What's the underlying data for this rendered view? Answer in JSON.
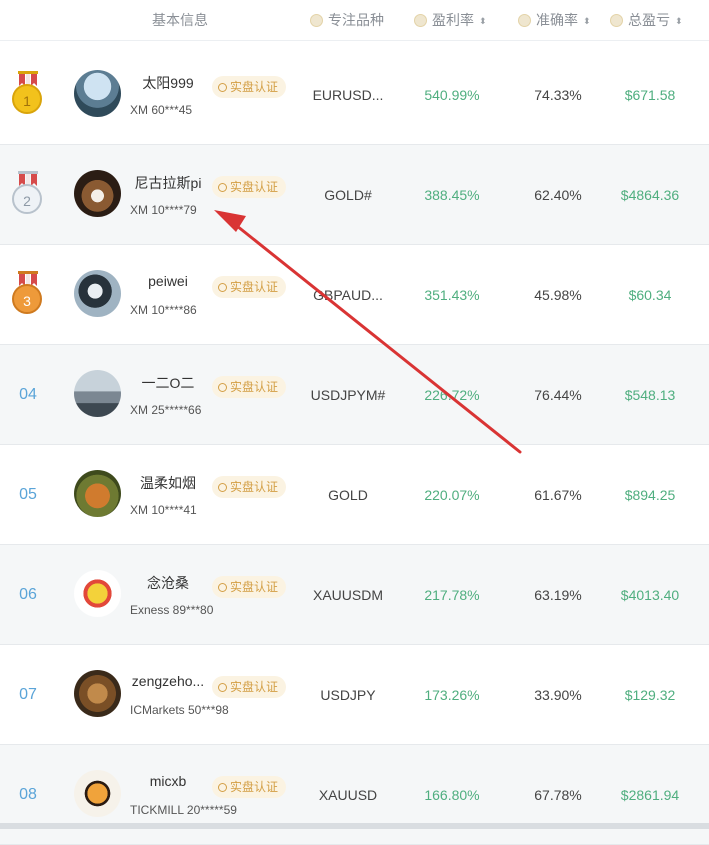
{
  "header": {
    "basic_info": "基本信息",
    "symbol": "专注品种",
    "profit_rate": "盈利率",
    "accuracy": "准确率",
    "total": "总盈亏",
    "sort_glyph": "⬍"
  },
  "badge_label": "实盘认证",
  "colors": {
    "profit": "#4fae7f",
    "rank_num": "#5aa4d8",
    "badge_bg": "#fbf3e2",
    "badge_text": "#d39f45",
    "arrow": "#d93434"
  },
  "rows": [
    {
      "rank": "1",
      "medal": "gold",
      "name": "太阳999",
      "account": "XM 60***45",
      "symbol": "EURUSD...",
      "profit_rate": "540.99%",
      "accuracy": "74.33%",
      "total": "$671.58",
      "avatar": "lake-landscape"
    },
    {
      "rank": "2",
      "medal": "silver",
      "name": "尼古拉斯pi",
      "account": "XM 10****79",
      "symbol": "GOLD#",
      "profit_rate": "388.45%",
      "accuracy": "62.40%",
      "total": "$4864.36",
      "avatar": "beagle-dog"
    },
    {
      "rank": "3",
      "medal": "bronze",
      "name": "peiwei",
      "account": "XM 10****86",
      "symbol": "GBPAUD...",
      "profit_rate": "351.43%",
      "accuracy": "45.98%",
      "total": "$60.34",
      "avatar": "bird"
    },
    {
      "rank": "04",
      "medal": "",
      "name": "一二O二",
      "account": "XM 25*****66",
      "symbol": "USDJPYM#",
      "profit_rate": "226.72%",
      "accuracy": "76.44%",
      "total": "$548.13",
      "avatar": "city-statue"
    },
    {
      "rank": "05",
      "medal": "",
      "name": "温柔如烟",
      "account": "XM 10****41",
      "symbol": "GOLD",
      "profit_rate": "220.07%",
      "accuracy": "61.67%",
      "total": "$894.25",
      "avatar": "squirrel"
    },
    {
      "rank": "06",
      "medal": "",
      "name": "念沧桑",
      "account": "Exness 89***80",
      "symbol": "XAUUSDM",
      "profit_rate": "217.78%",
      "accuracy": "63.19%",
      "total": "$4013.40",
      "avatar": "cartoon-character"
    },
    {
      "rank": "07",
      "medal": "",
      "name": "zengzeho...",
      "account": "ICMarkets 50***98",
      "symbol": "USDJPY",
      "profit_rate": "173.26%",
      "accuracy": "33.90%",
      "total": "$129.32",
      "avatar": "deer-cartoon"
    },
    {
      "rank": "08",
      "medal": "",
      "name": "micxb",
      "account": "TICKMILL 20*****59",
      "symbol": "XAUUSD",
      "profit_rate": "166.80%",
      "accuracy": "67.78%",
      "total": "$2861.94",
      "avatar": "tiger"
    }
  ]
}
